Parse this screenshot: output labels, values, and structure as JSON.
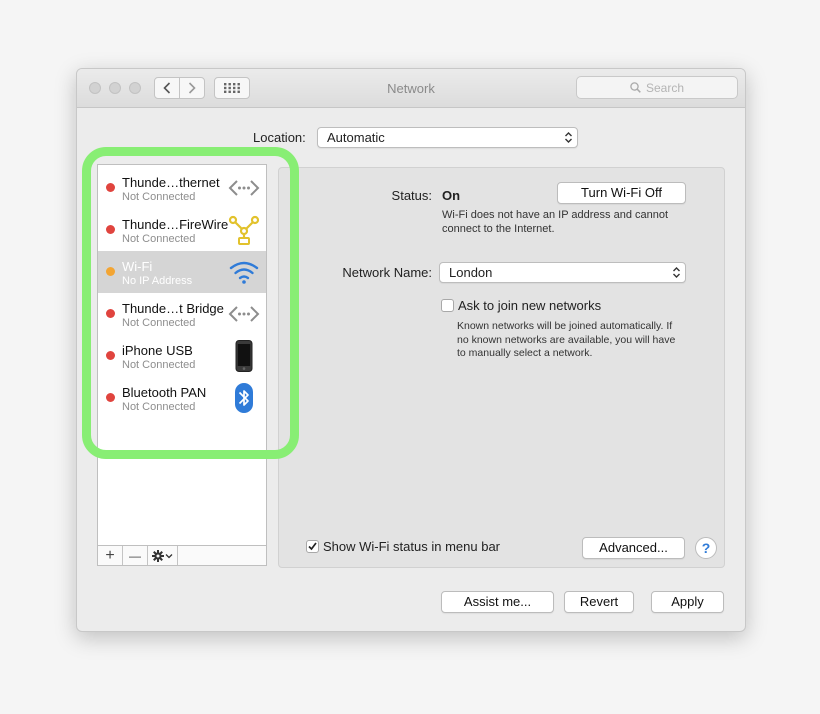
{
  "window": {
    "title": "Network"
  },
  "search": {
    "placeholder": "Search"
  },
  "location": {
    "label": "Location:",
    "value": "Automatic"
  },
  "services": [
    {
      "name": "Thunde…thernet",
      "status": "Not Connected",
      "state_color": "#e0443e",
      "icon": "ethernet-icon"
    },
    {
      "name": "Thunde…FireWire",
      "status": "Not Connected",
      "state_color": "#e0443e",
      "icon": "firewire-icon"
    },
    {
      "name": "Wi-Fi",
      "status": "No IP Address",
      "state_color": "#f3a533",
      "icon": "wifi-icon",
      "selected": true
    },
    {
      "name": "Thunde…t Bridge",
      "status": "Not Connected",
      "state_color": "#e0443e",
      "icon": "bridge-icon"
    },
    {
      "name": "iPhone USB",
      "status": "Not Connected",
      "state_color": "#e0443e",
      "icon": "iphone-icon"
    },
    {
      "name": "Bluetooth PAN",
      "status": "Not Connected",
      "state_color": "#e0443e",
      "icon": "bluetooth-icon"
    }
  ],
  "toolbar": {
    "add": "+",
    "remove": "—"
  },
  "detail": {
    "status_label": "Status:",
    "status_value": "On",
    "turn_off_button": "Turn Wi-Fi Off",
    "status_desc": [
      "Wi-Fi does not have an IP address and cannot",
      "connect to the Internet."
    ],
    "network_name_label": "Network Name:",
    "network_name_value": "London",
    "ask_join_label": "Ask to join new networks",
    "ask_join_checked": false,
    "ask_join_desc": [
      "Known networks will be joined automatically. If",
      "no known networks are available, you will have",
      "to manually select a network."
    ],
    "show_status_label": "Show Wi-Fi status in menu bar",
    "show_status_checked": true,
    "advanced_button": "Advanced...",
    "help_button": "?"
  },
  "footer": {
    "assist": "Assist me...",
    "revert": "Revert",
    "apply": "Apply"
  },
  "colors": {
    "highlight": "#88ee74",
    "accent": "#2f7bd8",
    "selected_row": "#d5d5d5"
  }
}
